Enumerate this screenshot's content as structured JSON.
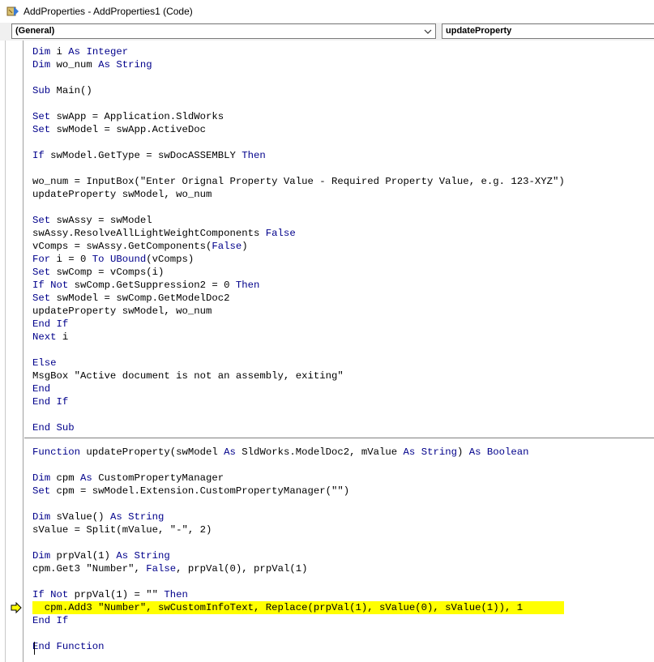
{
  "window": {
    "title": "AddProperties - AddProperties1 (Code)"
  },
  "dropdowns": {
    "object": "(General)",
    "procedure": "updateProperty"
  },
  "colors": {
    "keyword": "#00008b",
    "text": "#000000",
    "highlight": "#ffff00"
  },
  "icons": {
    "app": "vba-project-icon",
    "dropdown": "chevron-down-icon",
    "execution": "execution-point-arrow-icon"
  },
  "code": {
    "lines": [
      {
        "segments": [
          {
            "t": "Dim",
            "k": 1
          },
          {
            "t": " i "
          },
          {
            "t": "As",
            "k": 1
          },
          {
            "t": " "
          },
          {
            "t": "Integer",
            "k": 1
          }
        ]
      },
      {
        "segments": [
          {
            "t": "Dim",
            "k": 1
          },
          {
            "t": " wo_num "
          },
          {
            "t": "As",
            "k": 1
          },
          {
            "t": " "
          },
          {
            "t": "String",
            "k": 1
          }
        ]
      },
      {
        "segments": []
      },
      {
        "segments": [
          {
            "t": "Sub",
            "k": 1
          },
          {
            "t": " Main()"
          }
        ]
      },
      {
        "segments": []
      },
      {
        "segments": [
          {
            "t": "Set",
            "k": 1
          },
          {
            "t": " swApp = Application.SldWorks"
          }
        ]
      },
      {
        "segments": [
          {
            "t": "Set",
            "k": 1
          },
          {
            "t": " swModel = swApp.ActiveDoc"
          }
        ]
      },
      {
        "segments": []
      },
      {
        "segments": [
          {
            "t": "If",
            "k": 1
          },
          {
            "t": " swModel.GetType = swDocASSEMBLY "
          },
          {
            "t": "Then",
            "k": 1
          }
        ]
      },
      {
        "segments": []
      },
      {
        "segments": [
          {
            "t": "wo_num = InputBox(\"Enter Orignal Property Value - Required Property Value, e.g. 123-XYZ\")"
          }
        ]
      },
      {
        "segments": [
          {
            "t": "updateProperty swModel, wo_num"
          }
        ]
      },
      {
        "segments": []
      },
      {
        "segments": [
          {
            "t": "Set",
            "k": 1
          },
          {
            "t": " swAssy = swModel"
          }
        ]
      },
      {
        "segments": [
          {
            "t": "swAssy.ResolveAllLightWeightComponents "
          },
          {
            "t": "False",
            "k": 1
          }
        ]
      },
      {
        "segments": [
          {
            "t": "vComps = swAssy.GetComponents("
          },
          {
            "t": "False",
            "k": 1
          },
          {
            "t": ")"
          }
        ]
      },
      {
        "segments": [
          {
            "t": "For",
            "k": 1
          },
          {
            "t": " i = 0 "
          },
          {
            "t": "To",
            "k": 1
          },
          {
            "t": " "
          },
          {
            "t": "UBound",
            "k": 1
          },
          {
            "t": "(vComps)"
          }
        ]
      },
      {
        "segments": [
          {
            "t": "Set",
            "k": 1
          },
          {
            "t": " swComp = vComps(i)"
          }
        ]
      },
      {
        "segments": [
          {
            "t": "If",
            "k": 1
          },
          {
            "t": " "
          },
          {
            "t": "Not",
            "k": 1
          },
          {
            "t": " swComp.GetSuppression2 = 0 "
          },
          {
            "t": "Then",
            "k": 1
          }
        ]
      },
      {
        "segments": [
          {
            "t": "Set",
            "k": 1
          },
          {
            "t": " swModel = swComp.GetModelDoc2"
          }
        ]
      },
      {
        "segments": [
          {
            "t": "updateProperty swModel, wo_num"
          }
        ]
      },
      {
        "segments": [
          {
            "t": "End",
            "k": 1
          },
          {
            "t": " "
          },
          {
            "t": "If",
            "k": 1
          }
        ]
      },
      {
        "segments": [
          {
            "t": "Next",
            "k": 1
          },
          {
            "t": " i"
          }
        ]
      },
      {
        "segments": []
      },
      {
        "segments": [
          {
            "t": "Else",
            "k": 1
          }
        ]
      },
      {
        "segments": [
          {
            "t": "MsgBox \"Active document is not an assembly, exiting\""
          }
        ]
      },
      {
        "segments": [
          {
            "t": "End",
            "k": 1
          }
        ]
      },
      {
        "segments": [
          {
            "t": "End",
            "k": 1
          },
          {
            "t": " "
          },
          {
            "t": "If",
            "k": 1
          }
        ]
      },
      {
        "segments": []
      },
      {
        "segments": [
          {
            "t": "End",
            "k": 1
          },
          {
            "t": " "
          },
          {
            "t": "Sub",
            "k": 1
          }
        ]
      },
      {
        "separator": true
      },
      {
        "segments": [
          {
            "t": "Function",
            "k": 1
          },
          {
            "t": " updateProperty(swModel "
          },
          {
            "t": "As",
            "k": 1
          },
          {
            "t": " SldWorks.ModelDoc2, mValue "
          },
          {
            "t": "As",
            "k": 1
          },
          {
            "t": " "
          },
          {
            "t": "String",
            "k": 1
          },
          {
            "t": ") "
          },
          {
            "t": "As",
            "k": 1
          },
          {
            "t": " "
          },
          {
            "t": "Boolean",
            "k": 1
          }
        ]
      },
      {
        "segments": []
      },
      {
        "segments": [
          {
            "t": "Dim",
            "k": 1
          },
          {
            "t": " cpm "
          },
          {
            "t": "As",
            "k": 1
          },
          {
            "t": " CustomPropertyManager"
          }
        ]
      },
      {
        "segments": [
          {
            "t": "Set",
            "k": 1
          },
          {
            "t": " cpm = swModel.Extension.CustomPropertyManager(\"\")"
          }
        ]
      },
      {
        "segments": []
      },
      {
        "segments": [
          {
            "t": "Dim",
            "k": 1
          },
          {
            "t": " sValue() "
          },
          {
            "t": "As",
            "k": 1
          },
          {
            "t": " "
          },
          {
            "t": "String",
            "k": 1
          }
        ]
      },
      {
        "segments": [
          {
            "t": "sValue = Split(mValue, \"-\", 2)"
          }
        ]
      },
      {
        "segments": []
      },
      {
        "segments": [
          {
            "t": "Dim",
            "k": 1
          },
          {
            "t": " prpVal(1) "
          },
          {
            "t": "As",
            "k": 1
          },
          {
            "t": " "
          },
          {
            "t": "String",
            "k": 1
          }
        ]
      },
      {
        "segments": [
          {
            "t": "cpm.Get3 \"Number\", "
          },
          {
            "t": "False",
            "k": 1
          },
          {
            "t": ", prpVal(0), prpVal(1)"
          }
        ]
      },
      {
        "segments": []
      },
      {
        "segments": [
          {
            "t": "If",
            "k": 1
          },
          {
            "t": " "
          },
          {
            "t": "Not",
            "k": 1
          },
          {
            "t": " prpVal(1) = \"\" "
          },
          {
            "t": "Then",
            "k": 1
          }
        ]
      },
      {
        "segments": [
          {
            "t": "  cpm.Add3 \"Number\", swCustomInfoText, Replace(prpVal(1), sValue(0), sValue(1)), 1"
          }
        ],
        "current": true
      },
      {
        "segments": [
          {
            "t": "End",
            "k": 1
          },
          {
            "t": " "
          },
          {
            "t": "If",
            "k": 1
          }
        ]
      },
      {
        "segments": []
      },
      {
        "segments": [
          {
            "t": "End",
            "k": 1
          },
          {
            "t": " "
          },
          {
            "t": "Function",
            "k": 1
          }
        ]
      }
    ]
  }
}
